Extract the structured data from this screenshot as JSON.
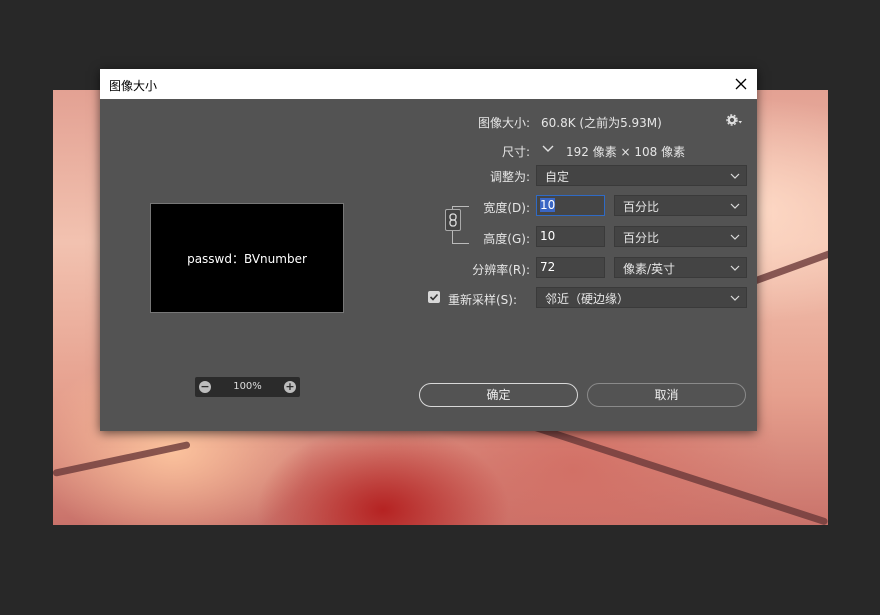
{
  "dialog": {
    "title": "图像大小"
  },
  "info": {
    "size_label": "图像大小:",
    "size_value": "60.8K (之前为5.93M)",
    "dimensions_label": "尺寸:",
    "dimensions_value": "192 像素 × 108 像素"
  },
  "fit_to": {
    "label": "调整为:",
    "selected": "自定"
  },
  "width": {
    "label": "宽度(D):",
    "value": "10",
    "unit": "百分比"
  },
  "height": {
    "label": "高度(G):",
    "value": "10",
    "unit": "百分比"
  },
  "resolution": {
    "label": "分辨率(R):",
    "value": "72",
    "unit": "像素/英寸"
  },
  "resample": {
    "label": "重新采样(S):",
    "checked": true,
    "method": "邻近（硬边缘）"
  },
  "preview": {
    "text": "passwd：BVnumber",
    "zoom": "100%"
  },
  "buttons": {
    "ok": "确定",
    "cancel": "取消"
  },
  "icons": {
    "close": "close-icon",
    "gear": "gear-icon",
    "chain": "link-chain-icon",
    "zoom_out": "zoom-out-icon",
    "zoom_in": "zoom-in-icon"
  }
}
